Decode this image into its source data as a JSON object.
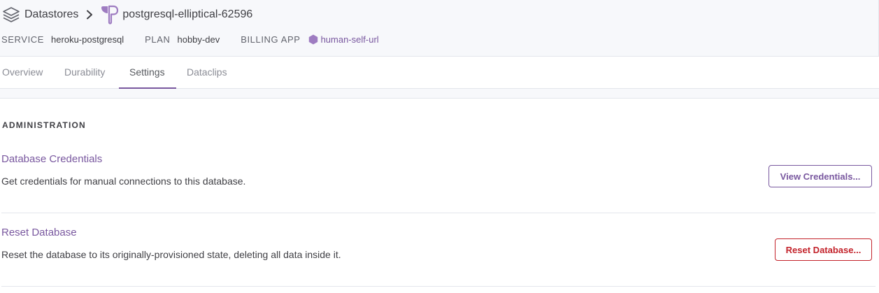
{
  "breadcrumb": {
    "datastores_label": "Datastores",
    "app_name": "postgresql-elliptical-62596",
    "icons": [
      "stack-icon",
      "chevron-right-icon",
      "postgres-elephant-icon"
    ]
  },
  "meta": {
    "service_label": "SERVICE",
    "service_value": "heroku-postgresql",
    "plan_label": "PLAN",
    "plan_value": "hobby-dev",
    "billing_label": "BILLING APP",
    "billing_value": "human-self-url",
    "billing_icon": "hexagon-icon"
  },
  "tabs": [
    {
      "label": "Overview",
      "active": false
    },
    {
      "label": "Durability",
      "active": false
    },
    {
      "label": "Settings",
      "active": true
    },
    {
      "label": "Dataclips",
      "active": false
    }
  ],
  "administration": {
    "heading": "ADMINISTRATION",
    "credentials": {
      "title": "Database Credentials",
      "description": "Get credentials for manual connections to this database.",
      "button": "View Credentials..."
    },
    "reset": {
      "title": "Reset Database",
      "description": "Reset the database to its originally-provisioned state, deleting all data inside it.",
      "button": "Reset Database..."
    }
  },
  "colors": {
    "accent": "#79589f",
    "danger": "#c3232b",
    "header_bg": "#f7f8fb",
    "border": "#e3e6ec"
  }
}
